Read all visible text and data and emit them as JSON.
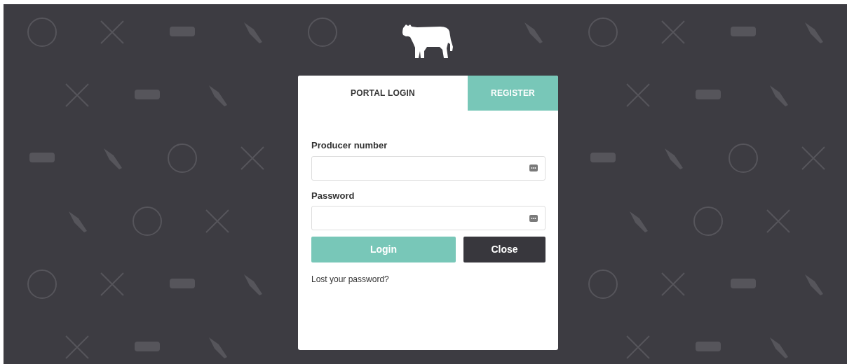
{
  "tabs": [
    {
      "label": "PORTAL LOGIN",
      "selected": true
    },
    {
      "label": "REGISTER",
      "selected": false
    }
  ],
  "fields": [
    {
      "label": "Producer number"
    },
    {
      "label": "Password"
    }
  ],
  "buttons": [
    {
      "label": "Login",
      "kind": "primary"
    },
    {
      "label": "Close",
      "kind": "dark"
    }
  ],
  "link": "Lost your password?"
}
